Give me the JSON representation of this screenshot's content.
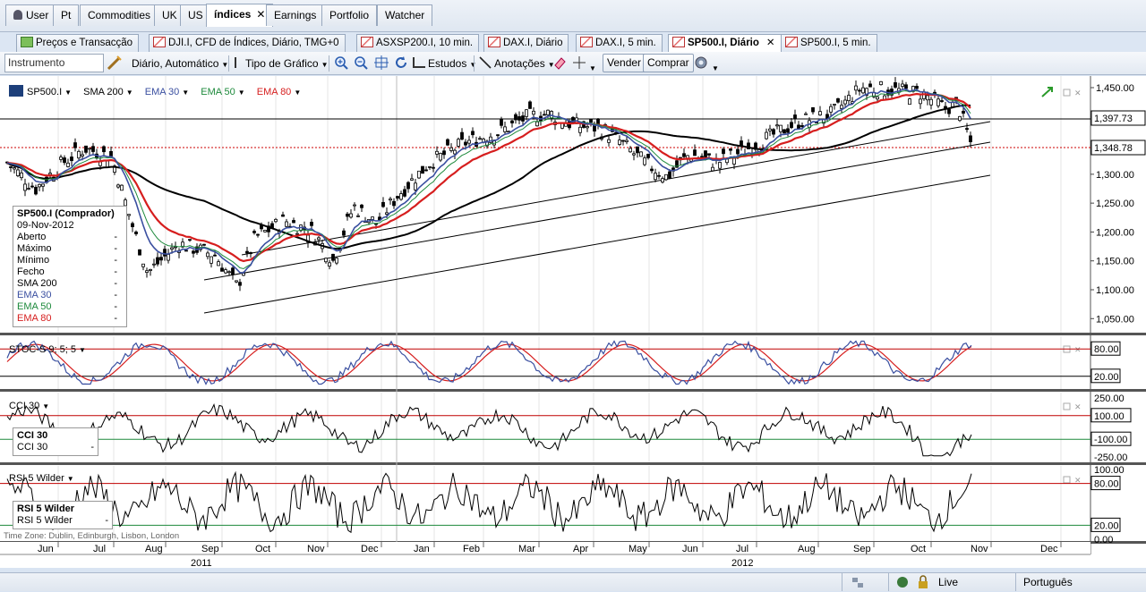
{
  "top_tabs": [
    {
      "label": "User",
      "icon": "user-icon"
    },
    {
      "label": "Pt"
    },
    {
      "label": "Commodities"
    },
    {
      "label": "UK"
    },
    {
      "label": "US"
    },
    {
      "label": "índices",
      "active": true,
      "close": "✕"
    },
    {
      "label": "Earnings"
    },
    {
      "label": "Portfolio"
    },
    {
      "label": "Watcher"
    }
  ],
  "doc_tabs": [
    {
      "label": "Preços e Transacção",
      "icon": "price-grid-icon"
    },
    {
      "label": "DJI.I, CFD de Índices, Diário, TMG+0",
      "icon": "chart-icon"
    },
    {
      "label": "ASXSP200.I, 10 min.",
      "icon": "chart-icon"
    },
    {
      "label": "DAX.I, Diário",
      "icon": "chart-icon"
    },
    {
      "label": "DAX.I, 5 min.",
      "icon": "chart-icon"
    },
    {
      "label": "SP500.I, Diário",
      "icon": "chart-icon",
      "active": true,
      "close": "✕"
    },
    {
      "label": "SP500.I, 5 min.",
      "icon": "chart-icon"
    }
  ],
  "toolbar": {
    "instrument_placeholder": "Instrumento",
    "period": "Diário,  Automático",
    "chart_type": "Tipo de Gráfico",
    "studies": "Estudos",
    "annotations": "Anotações",
    "sell": "Vender",
    "buy": "Comprar"
  },
  "legend": {
    "symbol": "SP500.I",
    "sma200": "SMA 200",
    "ema30": "EMA 30",
    "ema50": "EMA 50",
    "ema80": "EMA 80"
  },
  "colors": {
    "price": "#000000",
    "sma200": "#000000",
    "ema30": "#3a4fa0",
    "ema50": "#1e8a3c",
    "ema80": "#d61e1e",
    "stoch_k": "#3a4fa0",
    "stoch_d": "#d61e1e",
    "level_line": "#c00000",
    "mid_line": "#1e8a3c"
  },
  "price_axis": {
    "ticks": [
      "1,450.00",
      "1,400.00",
      "1,350.00",
      "1,300.00",
      "1,250.00",
      "1,200.00",
      "1,150.00",
      "1,100.00",
      "1,050.00"
    ],
    "last_upper": "1,397.73",
    "last_lower": "1,348.78"
  },
  "info_box": {
    "title": "SP500.I (Comprador)",
    "date": "09-Nov-2012",
    "rows": [
      {
        "label": "Aberto",
        "value": "-"
      },
      {
        "label": "Máximo",
        "value": "-"
      },
      {
        "label": "Mínimo",
        "value": "-"
      },
      {
        "label": "Fecho",
        "value": "-"
      },
      {
        "label": "SMA 200",
        "value": "-"
      },
      {
        "label": "EMA 30",
        "value": "-"
      },
      {
        "label": "EMA 50",
        "value": "-"
      },
      {
        "label": "EMA 80",
        "value": "-"
      }
    ]
  },
  "stoch": {
    "label": "STOC-S 9; 5; 5",
    "upper": "80.00",
    "lower": "20.00"
  },
  "cci": {
    "label": "CCI 30",
    "box_title": "CCI 30",
    "box_row": "CCI 30",
    "box_value": "-",
    "ticks": [
      "250.00",
      "100.00",
      "-100.00",
      "-250.00"
    ]
  },
  "rsi": {
    "label": "RSI 5 Wilder",
    "box_title": "RSI 5 Wilder",
    "box_row": "RSI 5 Wilder",
    "box_value": "-",
    "ticks": [
      "100.00",
      "80.00",
      "20.00",
      "0.00"
    ]
  },
  "timezone": "Time Zone: Dublin, Edinburgh, Lisbon, London",
  "x_axis": {
    "months": [
      "Jun",
      "Jul",
      "Aug",
      "Sep",
      "Oct",
      "Nov",
      "Dec",
      "Jan",
      "Feb",
      "Mar",
      "Apr",
      "May",
      "Jun",
      "Jul",
      "Aug",
      "Sep",
      "Oct",
      "Nov",
      "Dec"
    ],
    "years": [
      "2011",
      "2012"
    ]
  },
  "status": {
    "live": "Live",
    "language": "Português"
  }
}
